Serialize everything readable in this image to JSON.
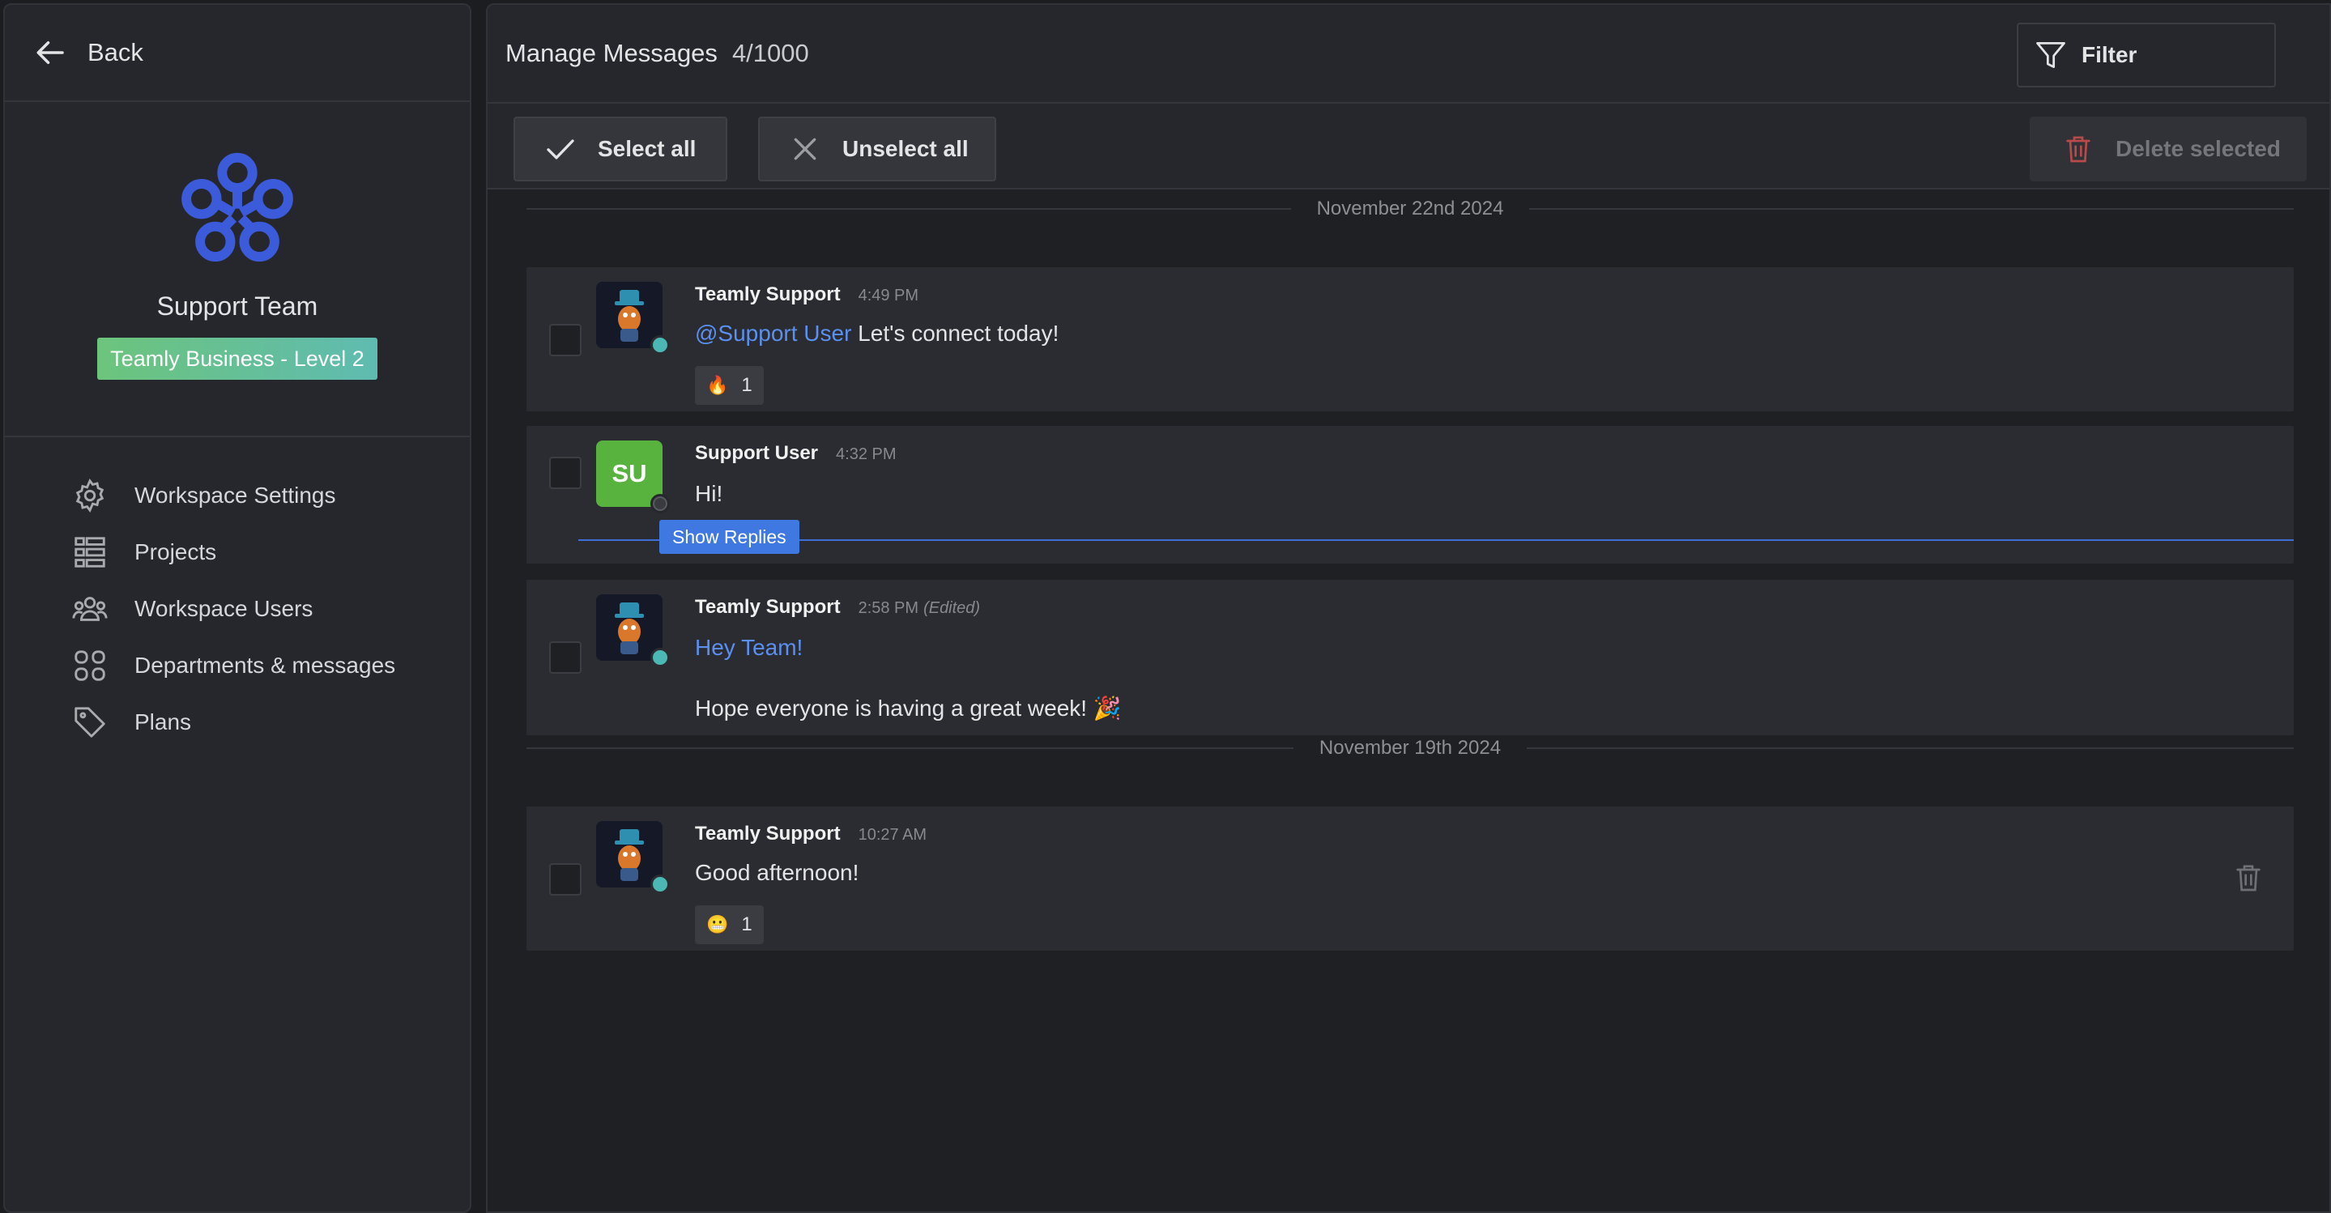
{
  "sidebar": {
    "back_label": "Back",
    "team_name": "Support Team",
    "plan_badge": "Teamly Business - Level 2",
    "nav": [
      {
        "label": "Workspace Settings",
        "icon": "gear-icon"
      },
      {
        "label": "Projects",
        "icon": "list-icon"
      },
      {
        "label": "Workspace Users",
        "icon": "users-icon"
      },
      {
        "label": "Departments & messages",
        "icon": "grid-icon"
      },
      {
        "label": "Plans",
        "icon": "tag-icon"
      }
    ]
  },
  "header": {
    "title": "Manage Messages",
    "count": "4/1000",
    "filter_label": "Filter"
  },
  "toolbar": {
    "select_all": "Select all",
    "unselect_all": "Unselect all",
    "delete_selected": "Delete selected"
  },
  "colors": {
    "accent": "#3f78e0",
    "mention": "#5b8ff0",
    "online": "#4bb8b5",
    "avatar_su": "#57b33e",
    "badge_start": "#6cc47c",
    "badge_end": "#5fbbb1"
  },
  "dates": [
    "November 22nd 2024",
    "November 19th 2024"
  ],
  "messages": [
    {
      "author": "Teamly Support",
      "time": "4:49 PM",
      "mention": "@Support User",
      "text": "Let's connect today!",
      "reaction": {
        "emoji": "🔥",
        "count": "1"
      }
    },
    {
      "author": "Support User",
      "initials": "SU",
      "time": "4:32 PM",
      "text": "Hi!",
      "show_replies": "Show Replies"
    },
    {
      "author": "Teamly Support",
      "time": "2:58 PM",
      "edited": "(Edited)",
      "mention": "Hey Team!",
      "text": "Hope everyone is having a great week! 🎉"
    },
    {
      "author": "Teamly Support",
      "time": "10:27 AM",
      "text": "Good afternoon!",
      "reaction": {
        "emoji": "😬",
        "count": "1"
      }
    }
  ]
}
